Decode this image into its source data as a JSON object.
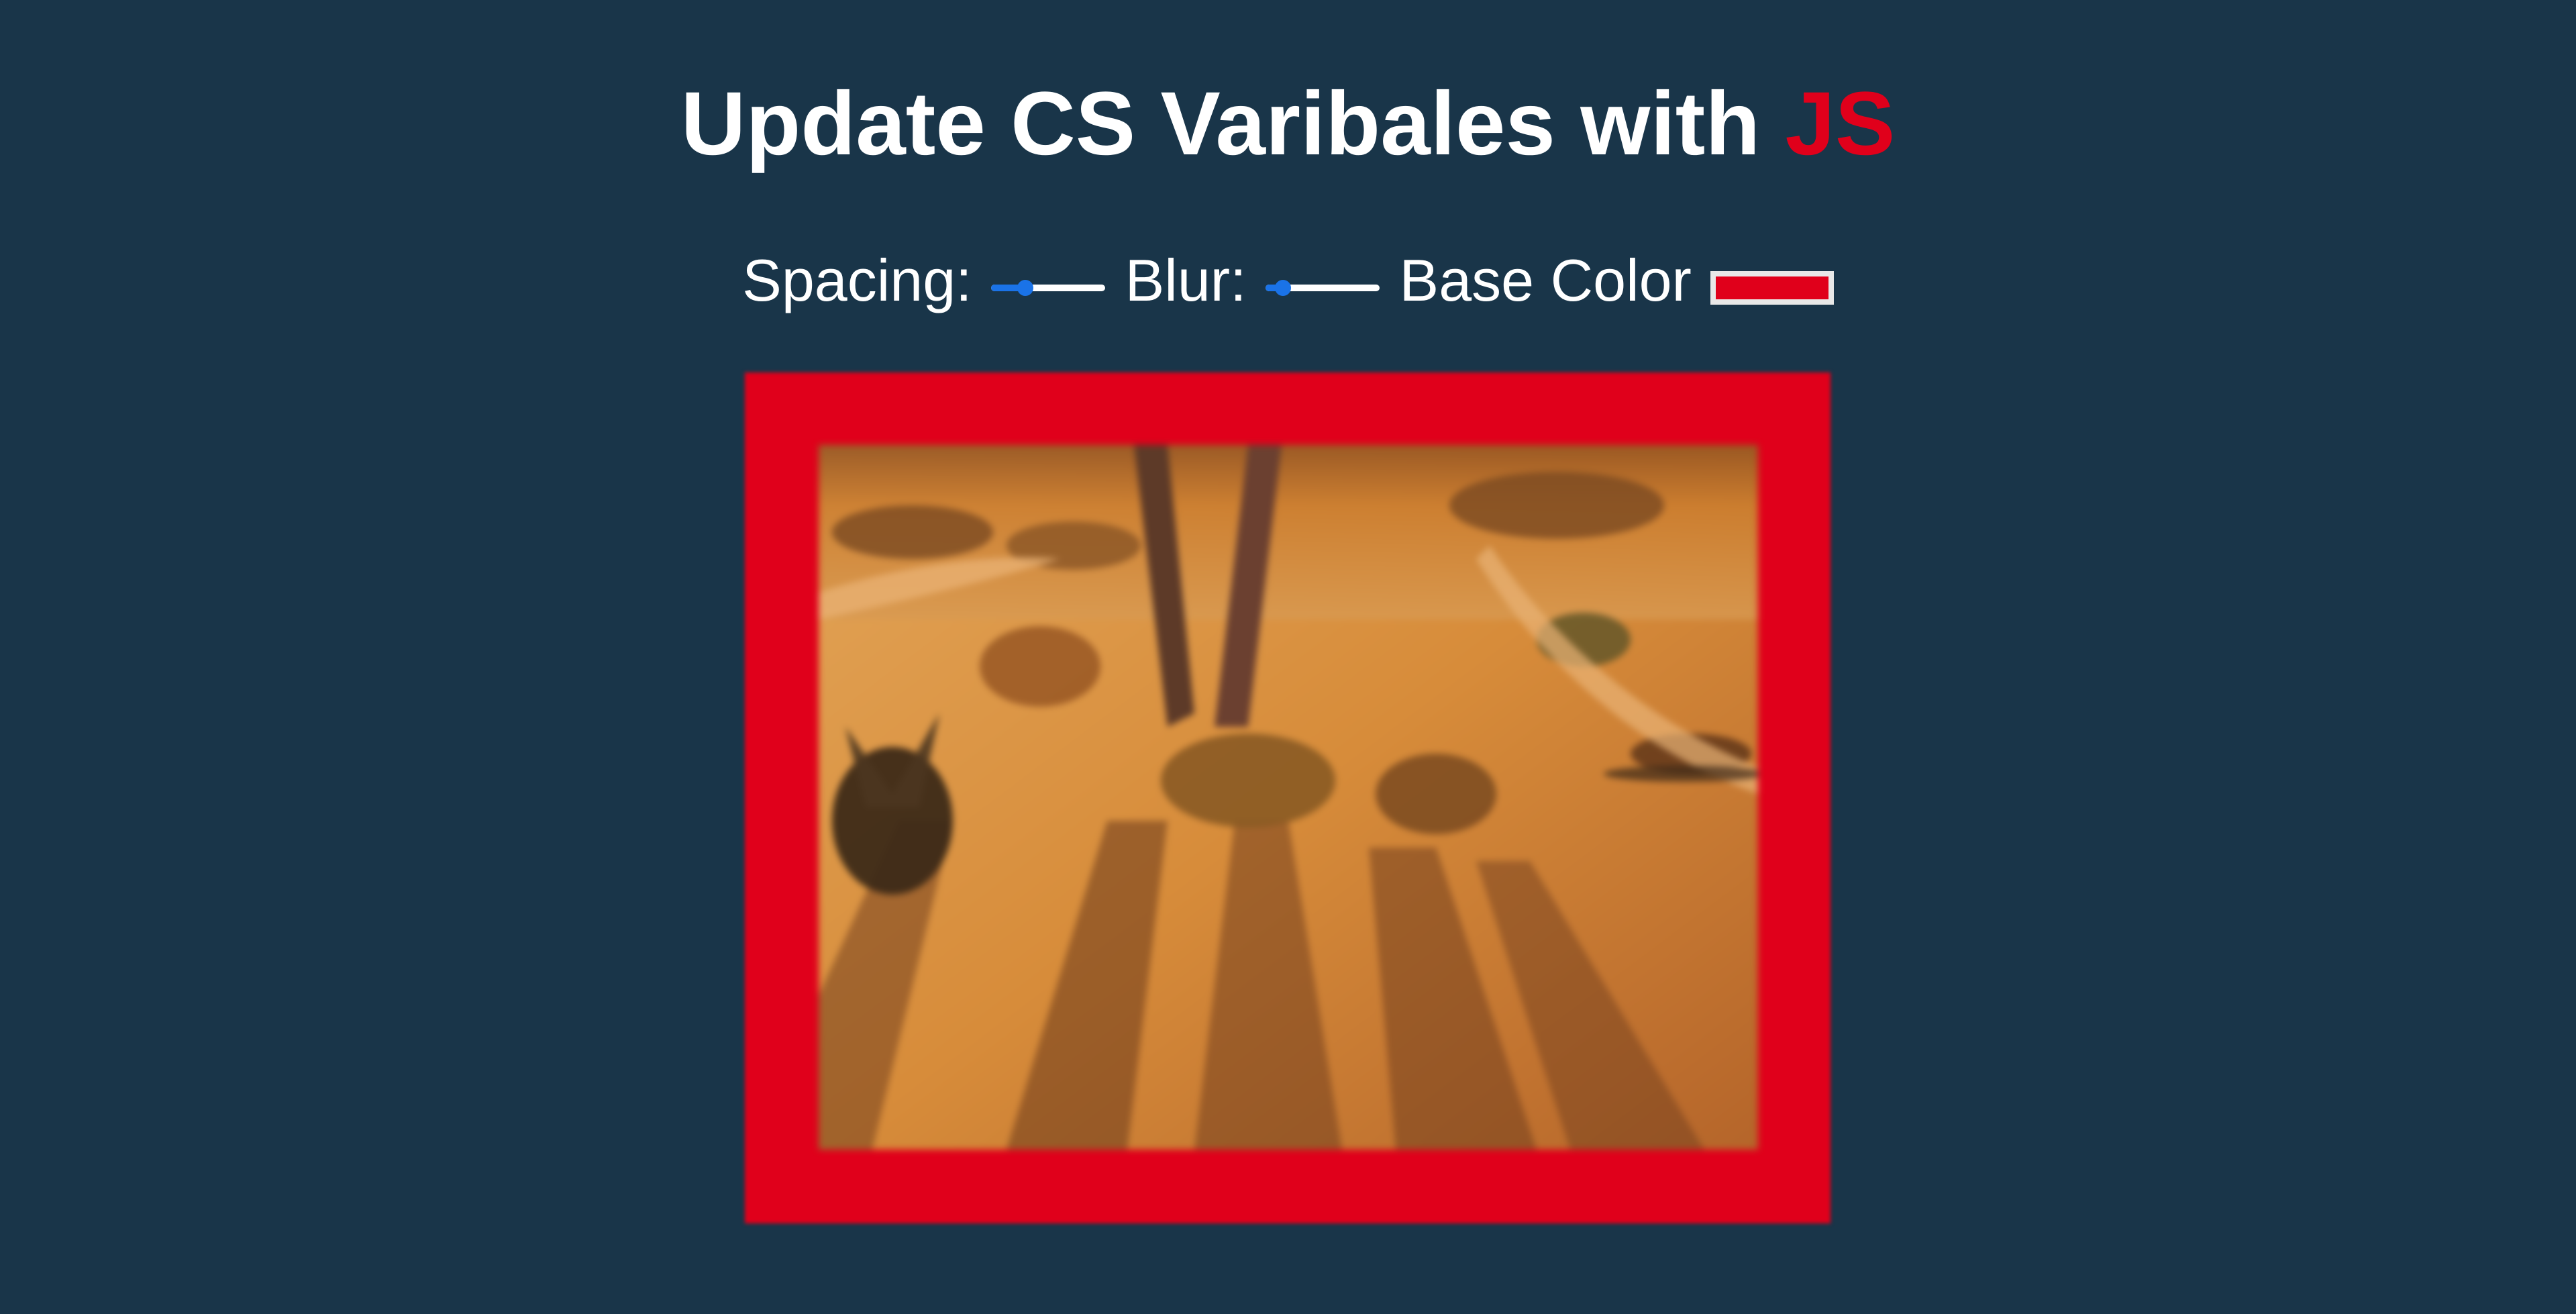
{
  "header": {
    "title_main": "Update CS Varibales with",
    "title_highlight": "JS"
  },
  "controls": {
    "spacing": {
      "label": "Spacing:",
      "value_fraction": 0.3
    },
    "blur": {
      "label": "Blur:",
      "value_fraction": 0.15
    },
    "base_color": {
      "label": "Base Color",
      "value": "#e0001b"
    }
  },
  "colors": {
    "background": "#193549",
    "accent": "#e0001b",
    "slider": "#1a73e8"
  },
  "image": {
    "icon": "desert-photo"
  }
}
